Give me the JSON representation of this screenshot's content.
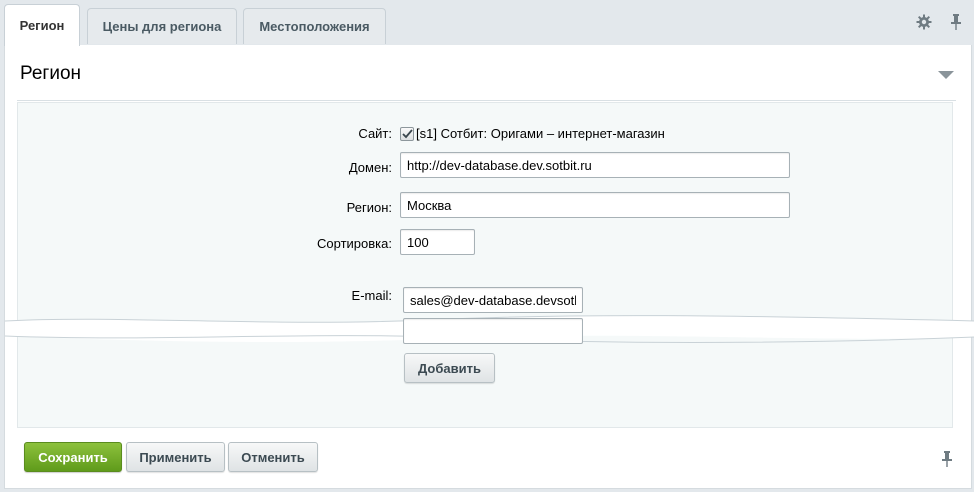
{
  "tabs": [
    {
      "label": "Регион",
      "active": true
    },
    {
      "label": "Цены для региона",
      "active": false
    },
    {
      "label": "Местоположения",
      "active": false
    }
  ],
  "toolbar": {
    "settings_icon": "gear-icon",
    "pin_icon": "pin-icon"
  },
  "section": {
    "title": "Регион",
    "collapse_icon": "triangle-down-icon"
  },
  "form": {
    "site": {
      "label": "Сайт:",
      "checked": true,
      "value": "[s1] Сотбит: Оригами – интернет-магазин"
    },
    "domain": {
      "label": "Домен:",
      "value": "http://dev-database.dev.sotbit.ru"
    },
    "region": {
      "label": "Регион:",
      "value": "Москва"
    },
    "sort": {
      "label": "Сортировка:",
      "value": "100"
    },
    "email": {
      "label": "E-mail:",
      "values": [
        "sales@dev-database.devsotbit.ru",
        ""
      ],
      "add_button": "Добавить"
    }
  },
  "actions": {
    "save": "Сохранить",
    "apply": "Применить",
    "cancel": "Отменить"
  },
  "colors": {
    "accent_green": "#6ba526",
    "background": "#e3e8ec",
    "form_bg": "#f5f9f9"
  }
}
